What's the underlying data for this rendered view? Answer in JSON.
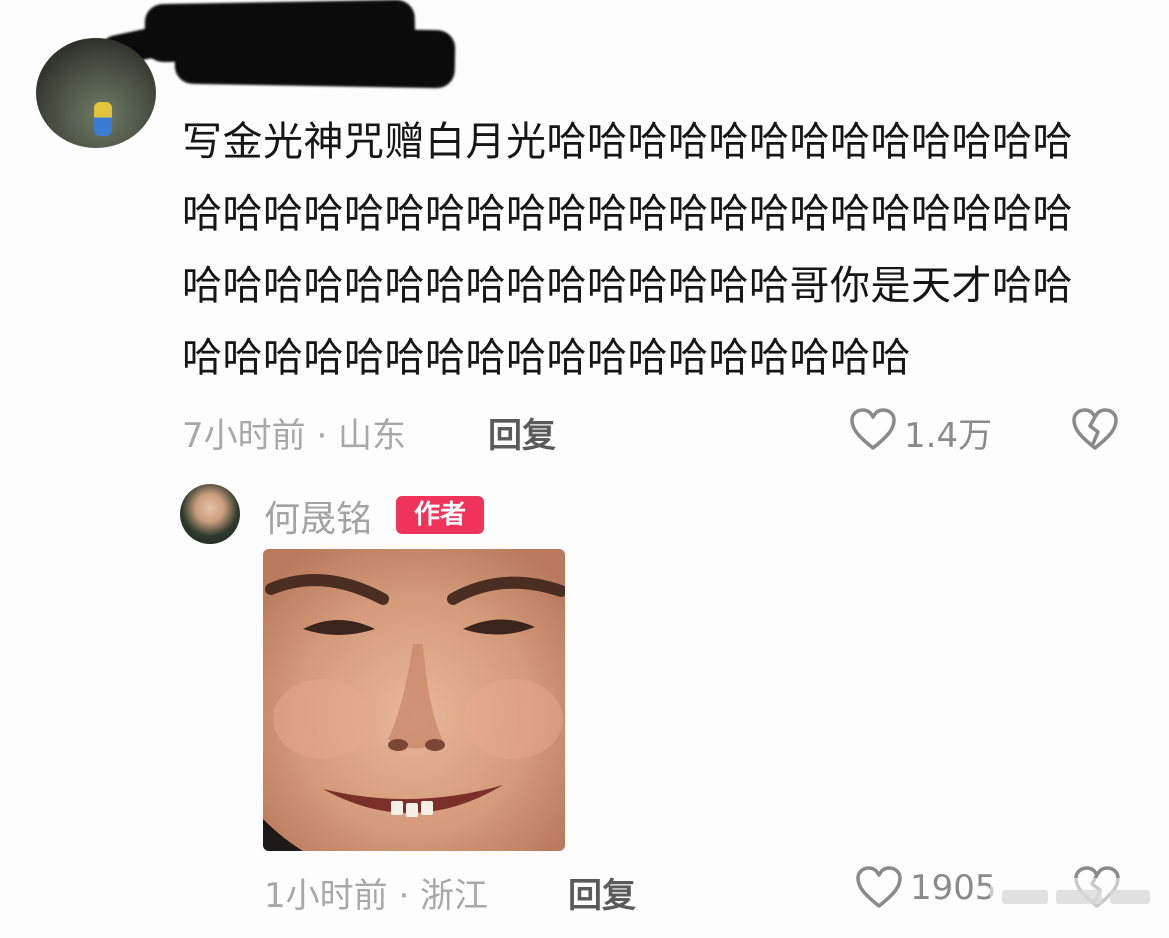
{
  "comment1": {
    "text": "写金光神咒赠白月光哈哈哈哈哈哈哈哈哈哈哈哈哈哈哈哈哈哈哈哈哈哈哈哈哈哈哈哈哈哈哈哈哈哈哈哈哈哈哈哈哈哈哈哈哈哈哈哈哈哈哥你是天才哈哈哈哈哈哈哈哈哈哈哈哈哈哈哈哈哈哈哈哈",
    "time_location": "7小时前 · 山东",
    "reply_label": "回复",
    "like_count": "1.4万"
  },
  "reply1": {
    "username": "何晟铭",
    "badge": "作者",
    "time_location": "1小时前 · 浙江",
    "reply_label": "回复",
    "like_count": "1905"
  },
  "colors": {
    "badge": "#f0335b",
    "text": "#161616",
    "meta": "#a8a8a8"
  },
  "icons": [
    "heart-outline-icon",
    "broken-heart-icon"
  ]
}
